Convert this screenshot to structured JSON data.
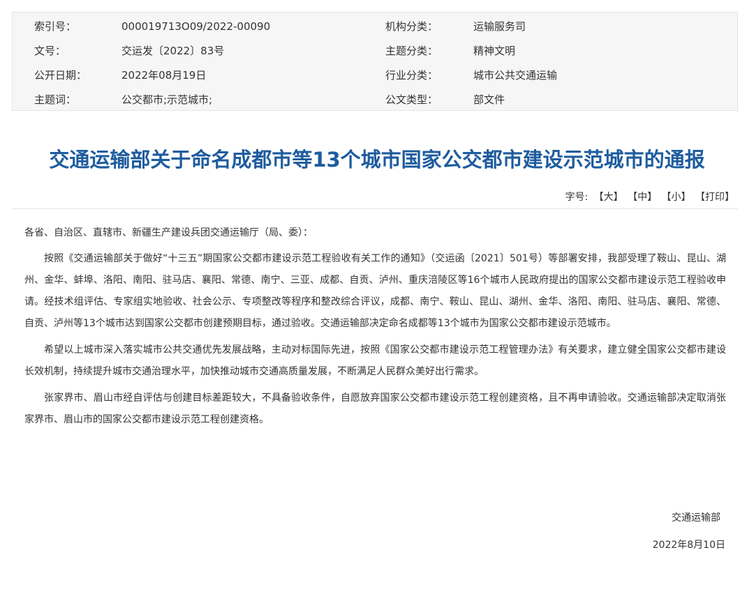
{
  "meta": {
    "rows": [
      {
        "label1": "索引号：",
        "value1": "000019713O09/2022-00090",
        "label2": "机构分类：",
        "value2": "运输服务司"
      },
      {
        "label1": "文号：",
        "value1": "交运发〔2022〕83号",
        "label2": "主题分类：",
        "value2": "精神文明"
      },
      {
        "label1": "公开日期：",
        "value1": "2022年08月19日",
        "label2": "行业分类：",
        "value2": "城市公共交通运输"
      },
      {
        "label1": "主题词：",
        "value1": "公交都市;示范城市;",
        "label2": "公文类型：",
        "value2": "部文件"
      }
    ]
  },
  "document": {
    "title": "交通运输部关于命名成都市等13个城市国家公交都市建设示范城市的通报",
    "font_controls": {
      "label": "字号:",
      "large": "【大】",
      "medium": "【中】",
      "small": "【小】",
      "print": "【打印】"
    },
    "salutation": "各省、自治区、直辖市、新疆生产建设兵团交通运输厅（局、委）：",
    "paragraphs": [
      "按照《交通运输部关于做好“十三五”期国家公交都市建设示范工程验收有关工作的通知》（交运函〔2021〕501号）等部署安排，我部受理了鞍山、昆山、湖州、金华、蚌埠、洛阳、南阳、驻马店、襄阳、常德、南宁、三亚、成都、自贡、泸州、重庆涪陵区等16个城市人民政府提出的国家公交都市建设示范工程验收申请。经技术组评估、专家组实地验收、社会公示、专项整改等程序和整改综合评议，成都、南宁、鞍山、昆山、湖州、金华、洛阳、南阳、驻马店、襄阳、常德、自贡、泸州等13个城市达到国家公交都市创建预期目标，通过验收。交通运输部决定命名成都等13个城市为国家公交都市建设示范城市。",
      "希望以上城市深入落实城市公共交通优先发展战略，主动对标国际先进，按照《国家公交都市建设示范工程管理办法》有关要求，建立健全国家公交都市建设长效机制，持续提升城市交通治理水平，加快推动城市交通高质量发展，不断满足人民群众美好出行需求。",
      "张家界市、眉山市经自评估与创建目标差距较大，不具备验收条件，自愿放弃国家公交都市建设示范工程创建资格，且不再申请验收。交通运输部决定取消张家界市、眉山市的国家公交都市建设示范工程创建资格。"
    ],
    "signature_org": "交通运输部",
    "signature_date": "2022年8月10日"
  },
  "colors": {
    "title": "#1e5c9e",
    "meta_bg": "#f6f6f6",
    "text": "#333333"
  }
}
